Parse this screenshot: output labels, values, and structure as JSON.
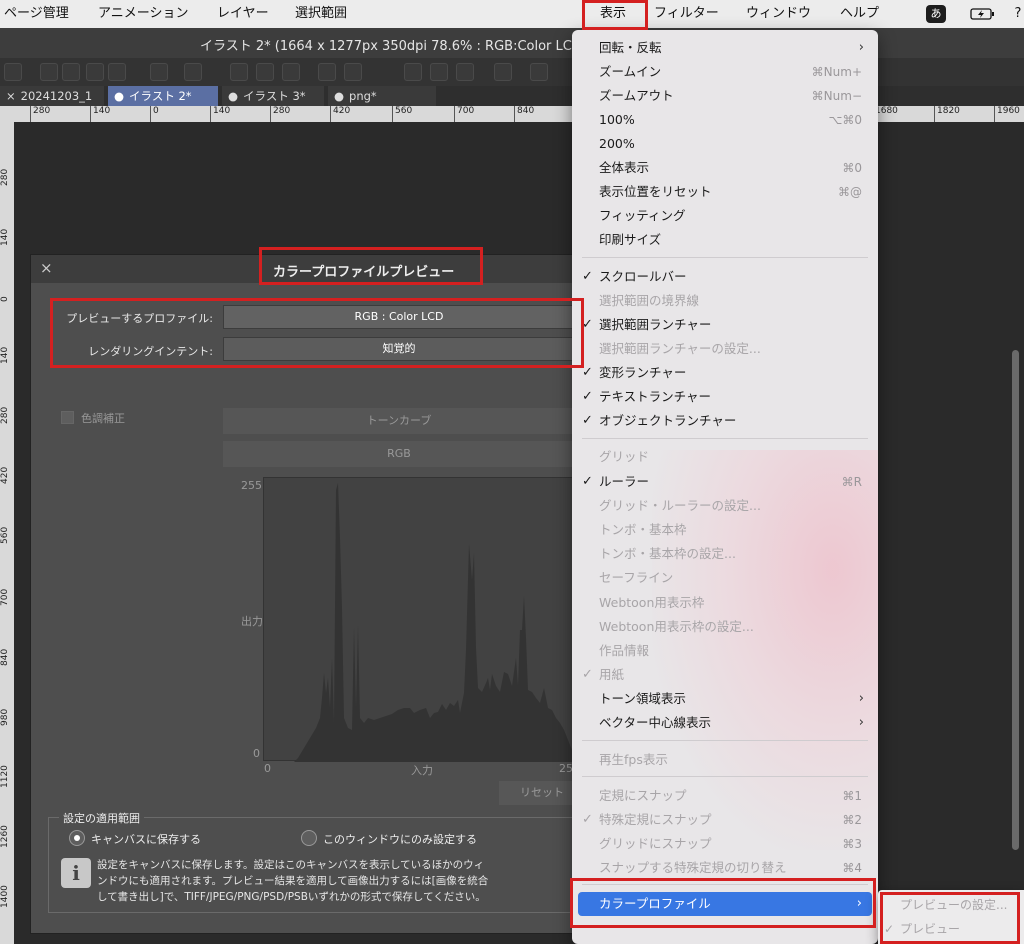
{
  "menubar": {
    "items": [
      "ページ管理",
      "アニメーション",
      "レイヤー",
      "選択範囲",
      "表示",
      "フィルター",
      "ウィンドウ",
      "ヘルプ"
    ],
    "status_ime": "あ"
  },
  "window": {
    "title": "イラスト 2* (1664 x 1277px 350dpi 78.6% : RGB:Color LC"
  },
  "tabs": [
    {
      "mark": "×",
      "label": "20241203_1"
    },
    {
      "mark": "●",
      "label": "イラスト 2*"
    },
    {
      "mark": "●",
      "label": "イラスト 3*"
    },
    {
      "mark": "●",
      "label": "png*"
    }
  ],
  "rulers": {
    "h_labels": [
      "280",
      "140",
      "0",
      "140",
      "280",
      "420",
      "560",
      "700",
      "840",
      "1680",
      "1820",
      "1960"
    ],
    "v_labels": [
      "280",
      "140",
      "0",
      "140",
      "280",
      "420",
      "560",
      "700",
      "840",
      "980",
      "1120",
      "1260",
      "1400"
    ]
  },
  "dialog": {
    "title": "カラープロファイルプレビュー",
    "close": "×",
    "preview_profile_label": "プレビューするプロファイル:",
    "preview_profile_value": "RGB : Color LCD",
    "rendering_intent_label": "レンダリングインテント:",
    "rendering_intent_value": "知覚的",
    "tone_correction_label": "色調補正",
    "tone_curve_value": "トーンカーブ",
    "channel_value": "RGB",
    "graph": {
      "y_max": "255",
      "y_min": "0",
      "x_min": "0",
      "x_max": "25",
      "y_axis_label": "出力",
      "x_axis_label": "入力"
    },
    "reset_label": "リセット",
    "scope": {
      "title": "設定の適用範囲",
      "option_canvas": "キャンバスに保存する",
      "option_window": "このウィンドウにのみ設定する",
      "info_icon": "i",
      "info_text_lines": [
        "設定をキャンバスに保存します。設定はこのキャンバスを表示しているほかのウィ",
        "ンドウにも適用されます。プレビュー結果を適用して画像出力するには[画像を統合",
        "して書き出し]で、TIFF/JPEG/PNG/PSD/PSBいずれかの形式で保存してください。"
      ]
    }
  },
  "menu": {
    "items": [
      {
        "label": "回転・反転",
        "arrow": "›"
      },
      {
        "label": "ズームイン",
        "shortcut": "⌘Num+"
      },
      {
        "label": "ズームアウト",
        "shortcut": "⌘Num−"
      },
      {
        "label": "100%",
        "shortcut": "⌥⌘0"
      },
      {
        "label": "200%"
      },
      {
        "label": "全体表示",
        "shortcut": "⌘0"
      },
      {
        "label": "表示位置をリセット",
        "shortcut": "⌘@"
      },
      {
        "label": "フィッティング"
      },
      {
        "label": "印刷サイズ"
      },
      {
        "label": "スクロールバー",
        "check": "✓"
      },
      {
        "label": "選択範囲の境界線",
        "disabled": true
      },
      {
        "label": "選択範囲ランチャー",
        "check": "✓"
      },
      {
        "label": "選択範囲ランチャーの設定...",
        "disabled": true
      },
      {
        "label": "変形ランチャー",
        "check": "✓"
      },
      {
        "label": "テキストランチャー",
        "check": "✓"
      },
      {
        "label": "オブジェクトランチャー",
        "check": "✓"
      },
      {
        "label": "グリッド",
        "disabled": true
      },
      {
        "label": "ルーラー",
        "check": "✓",
        "shortcut": "⌘R"
      },
      {
        "label": "グリッド・ルーラーの設定...",
        "disabled": true
      },
      {
        "label": "トンボ・基本枠",
        "disabled": true
      },
      {
        "label": "トンボ・基本枠の設定...",
        "disabled": true
      },
      {
        "label": "セーフライン",
        "disabled": true
      },
      {
        "label": "Webtoon用表示枠",
        "disabled": true
      },
      {
        "label": "Webtoon用表示枠の設定...",
        "disabled": true
      },
      {
        "label": "作品情報",
        "disabled": true
      },
      {
        "label": "用紙",
        "check": "✓",
        "disabled": true
      },
      {
        "label": "トーン領域表示",
        "arrow": "›"
      },
      {
        "label": "ベクター中心線表示",
        "arrow": "›"
      },
      {
        "label": "再生fps表示",
        "disabled": true
      },
      {
        "label": "定規にスナップ",
        "shortcut": "⌘1",
        "disabled": true
      },
      {
        "label": "特殊定規にスナップ",
        "check": "✓",
        "shortcut": "⌘2",
        "disabled": true
      },
      {
        "label": "グリッドにスナップ",
        "shortcut": "⌘3",
        "disabled": true
      },
      {
        "label": "スナップする特殊定規の切り替え",
        "shortcut": "⌘4",
        "disabled": true
      }
    ],
    "color_profile": {
      "label": "カラープロファイル",
      "arrow": "›"
    }
  },
  "submenu": {
    "items": [
      {
        "label": "プレビューの設定..."
      },
      {
        "label": "プレビュー",
        "check": "✓"
      }
    ]
  },
  "annotation_color": "#d42020"
}
